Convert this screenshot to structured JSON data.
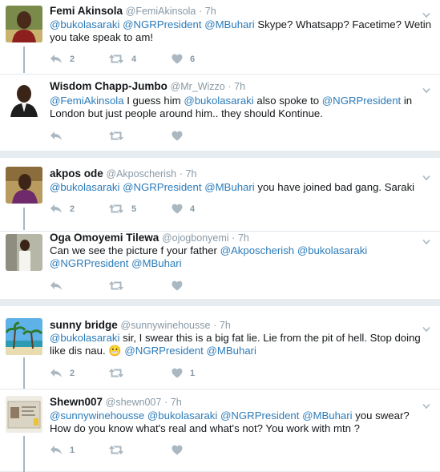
{
  "colors": {
    "link": "#2b7bb9",
    "muted": "#8899a6",
    "thread": "#a7b6c2",
    "bg": "#e6ecf0"
  },
  "groups": [
    {
      "tweets": [
        {
          "name": "Femi Akinsola",
          "handle": "@FemiAkinsola",
          "time": "7h",
          "text": [
            {
              "m": "@bukolasaraki"
            },
            {
              "t": " "
            },
            {
              "m": "@NGRPresident"
            },
            {
              "t": " "
            },
            {
              "m": "@MBuhari"
            },
            {
              "t": " Skype? Whatsapp? Facetime? Wetin you take speak to am!"
            }
          ],
          "replies": "2",
          "retweets": "4",
          "likes": "6",
          "avatar": "femi-avatar"
        },
        {
          "name": "Wisdom Chapp-Jumbo",
          "handle": "@Mr_Wizzo",
          "time": "7h",
          "text": [
            {
              "m": "@FemiAkinsola"
            },
            {
              "t": " I guess him "
            },
            {
              "m": "@bukolasaraki"
            },
            {
              "t": " also spoke to "
            },
            {
              "m": "@NGRPresident"
            },
            {
              "t": " in London but just people around him.. they should Kontinue."
            }
          ],
          "replies": "",
          "retweets": "",
          "likes": "",
          "avatar": "wisdom-avatar"
        }
      ]
    },
    {
      "tweets": [
        {
          "name": "akpos ode",
          "handle": "@Akposcherish",
          "time": "7h",
          "text": [
            {
              "m": "@bukolasaraki"
            },
            {
              "t": " "
            },
            {
              "m": "@NGRPresident"
            },
            {
              "t": " "
            },
            {
              "m": "@MBuhari"
            },
            {
              "t": " you have joined bad gang. Saraki"
            }
          ],
          "replies": "2",
          "retweets": "5",
          "likes": "4",
          "avatar": "akpos-avatar"
        },
        {
          "name": "Oga Omoyemi Tilewa",
          "handle": "@ojogbonyemi",
          "time": "7h",
          "text": [
            {
              "t": "Can we see the picture f your father "
            },
            {
              "m": "@Akposcherish"
            },
            {
              "t": " "
            },
            {
              "m": "@bukolasaraki"
            },
            {
              "t": " "
            },
            {
              "m": "@NGRPresident"
            },
            {
              "t": " "
            },
            {
              "m": "@MBuhari"
            }
          ],
          "replies": "",
          "retweets": "",
          "likes": "",
          "avatar": "oga-avatar"
        }
      ]
    },
    {
      "tweets": [
        {
          "name": "sunny bridge",
          "handle": "@sunnywinehousse",
          "time": "7h",
          "text": [
            {
              "m": "@bukolasaraki"
            },
            {
              "t": " sir, I swear this is a big fat lie. Lie from the pit of hell. Stop doing like dis nau. "
            },
            {
              "e": "😬"
            },
            {
              "t": " "
            },
            {
              "m": "@NGRPresident"
            },
            {
              "t": " "
            },
            {
              "m": "@MBuhari"
            }
          ],
          "replies": "2",
          "retweets": "",
          "likes": "1",
          "avatar": "sunny-avatar"
        },
        {
          "name": "Shewn007",
          "handle": "@shewn007",
          "time": "7h",
          "text": [
            {
              "m": "@sunnywinehousse"
            },
            {
              "t": " "
            },
            {
              "m": "@bukolasaraki"
            },
            {
              "t": " "
            },
            {
              "m": "@NGRPresident"
            },
            {
              "t": " "
            },
            {
              "m": "@MBuhari"
            },
            {
              "t": " you swear?  How do you know what's real and what's not? You work with mtn ?"
            }
          ],
          "replies": "1",
          "retweets": "",
          "likes": "",
          "avatar": "shewn-avatar"
        }
      ]
    }
  ],
  "dot": "·"
}
